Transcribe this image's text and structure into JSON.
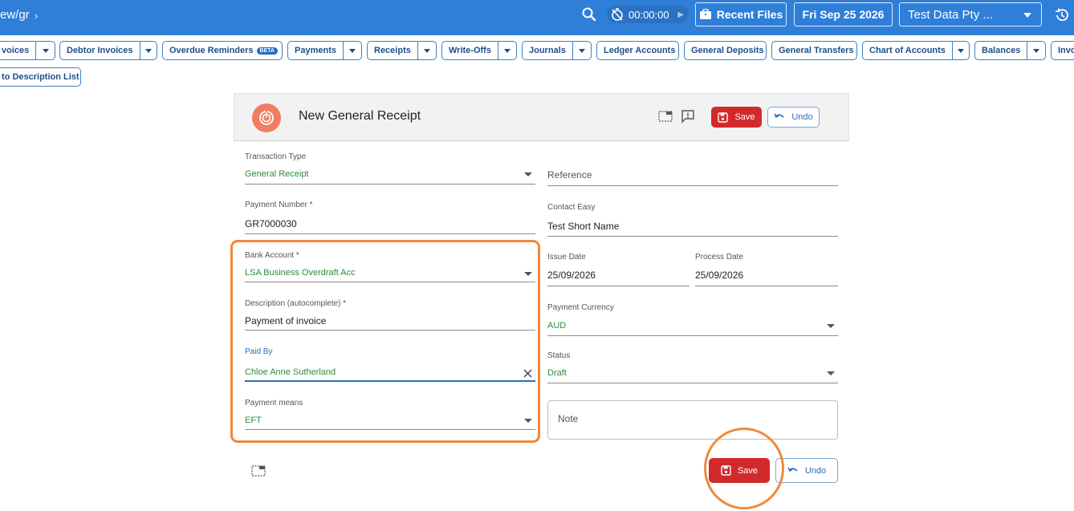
{
  "topbar": {
    "breadcrumb": "ew/gr",
    "timer": "00:00:00",
    "recent_files": "Recent Files",
    "date": "Fri Sep 25 2026",
    "company": "Test Data Pty ...",
    "accent": "#2f7fd9"
  },
  "nav": {
    "items": [
      {
        "label": "voices"
      },
      {
        "label": "Debtor Invoices"
      },
      {
        "label": "Overdue Reminders",
        "badge": "BETA"
      },
      {
        "label": "Payments"
      },
      {
        "label": "Receipts"
      },
      {
        "label": "Write-Offs"
      },
      {
        "label": "Journals"
      },
      {
        "label": "Ledger Accounts"
      },
      {
        "label": "General Deposits"
      },
      {
        "label": "General Transfers"
      },
      {
        "label": "Chart of Accounts"
      },
      {
        "label": "Balances"
      },
      {
        "label": "Invo"
      }
    ],
    "second_row": "to Description List"
  },
  "card": {
    "title": "New General Receipt",
    "save_label": "Save",
    "undo_label": "Undo"
  },
  "form": {
    "transaction_type": {
      "label": "Transaction Type",
      "value": "General Receipt"
    },
    "reference": {
      "placeholder": "Reference"
    },
    "payment_number": {
      "label": "Payment Number *",
      "value": "GR7000030"
    },
    "contact": {
      "label": "Contact Easy",
      "value": "Test Short Name"
    },
    "bank_account": {
      "label": "Bank Account *",
      "value": "LSA Business Overdraft Acc"
    },
    "issue_date": {
      "label": "Issue Date",
      "value": "25/09/2026"
    },
    "process_date": {
      "label": "Process Date",
      "value": "25/09/2026"
    },
    "description": {
      "label": "Description (autocomplete) *",
      "value": "Payment of invoice"
    },
    "payment_currency": {
      "label": "Payment Currency",
      "value": "AUD"
    },
    "paid_by": {
      "label": "Paid By",
      "value": "Chloe Anne Sutherland"
    },
    "status": {
      "label": "Status",
      "value": "Draft"
    },
    "payment_means": {
      "label": "Payment means",
      "value": "EFT"
    },
    "note": {
      "placeholder": "Note"
    }
  },
  "footer": {
    "save_label": "Save",
    "undo_label": "Undo"
  },
  "colors": {
    "highlight": "#f0893a",
    "save": "#d22a2a",
    "green_value": "#2e8b3d"
  }
}
